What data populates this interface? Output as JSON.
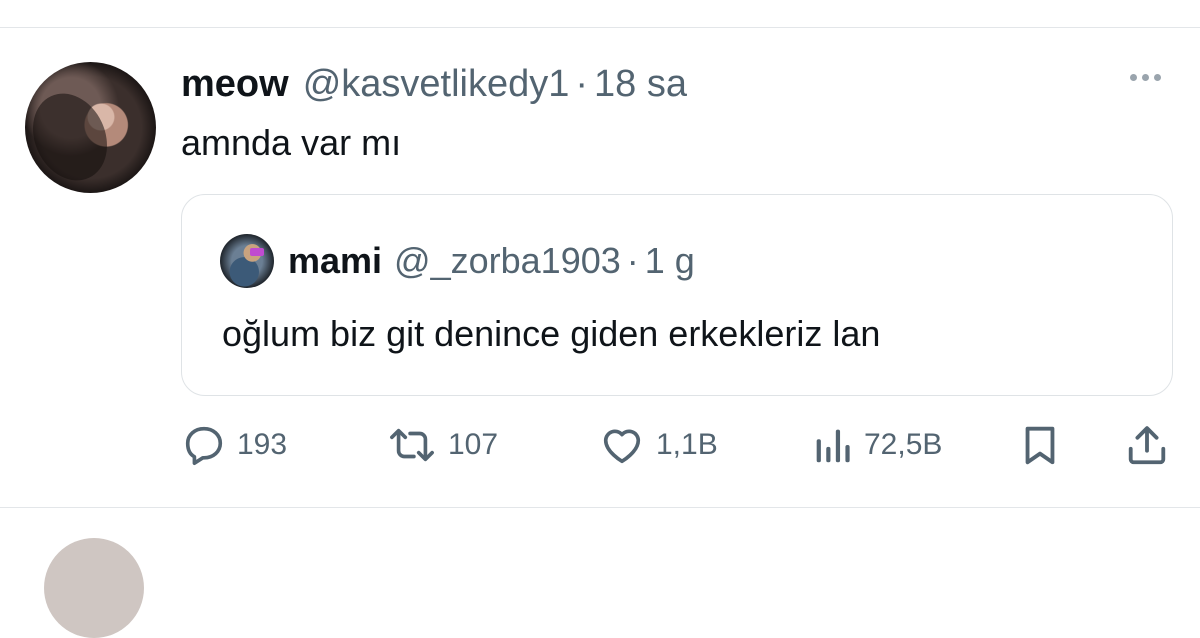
{
  "tweet": {
    "display_name": "meow",
    "handle": "@kasvetlikedy1",
    "separator": "·",
    "time": "18 sa",
    "text": "amnda var mı"
  },
  "quoted_tweet": {
    "display_name": "mami",
    "handle": "@_zorba1903",
    "separator": "·",
    "time": "1 g",
    "text": "oğlum biz git denince giden erkekleriz lan"
  },
  "actions": {
    "reply": {
      "icon": "reply-icon",
      "count": "193"
    },
    "retweet": {
      "icon": "retweet-icon",
      "count": "107"
    },
    "like": {
      "icon": "heart-icon",
      "count": "1,1B"
    },
    "views": {
      "icon": "views-icon",
      "count": "72,5B"
    },
    "bookmark": {
      "icon": "bookmark-icon"
    },
    "share": {
      "icon": "share-icon"
    }
  },
  "more_menu_icon": "more-dots-icon",
  "colors": {
    "text_primary": "#0f1419",
    "text_secondary": "#536471",
    "border": "#dfe3e6"
  }
}
